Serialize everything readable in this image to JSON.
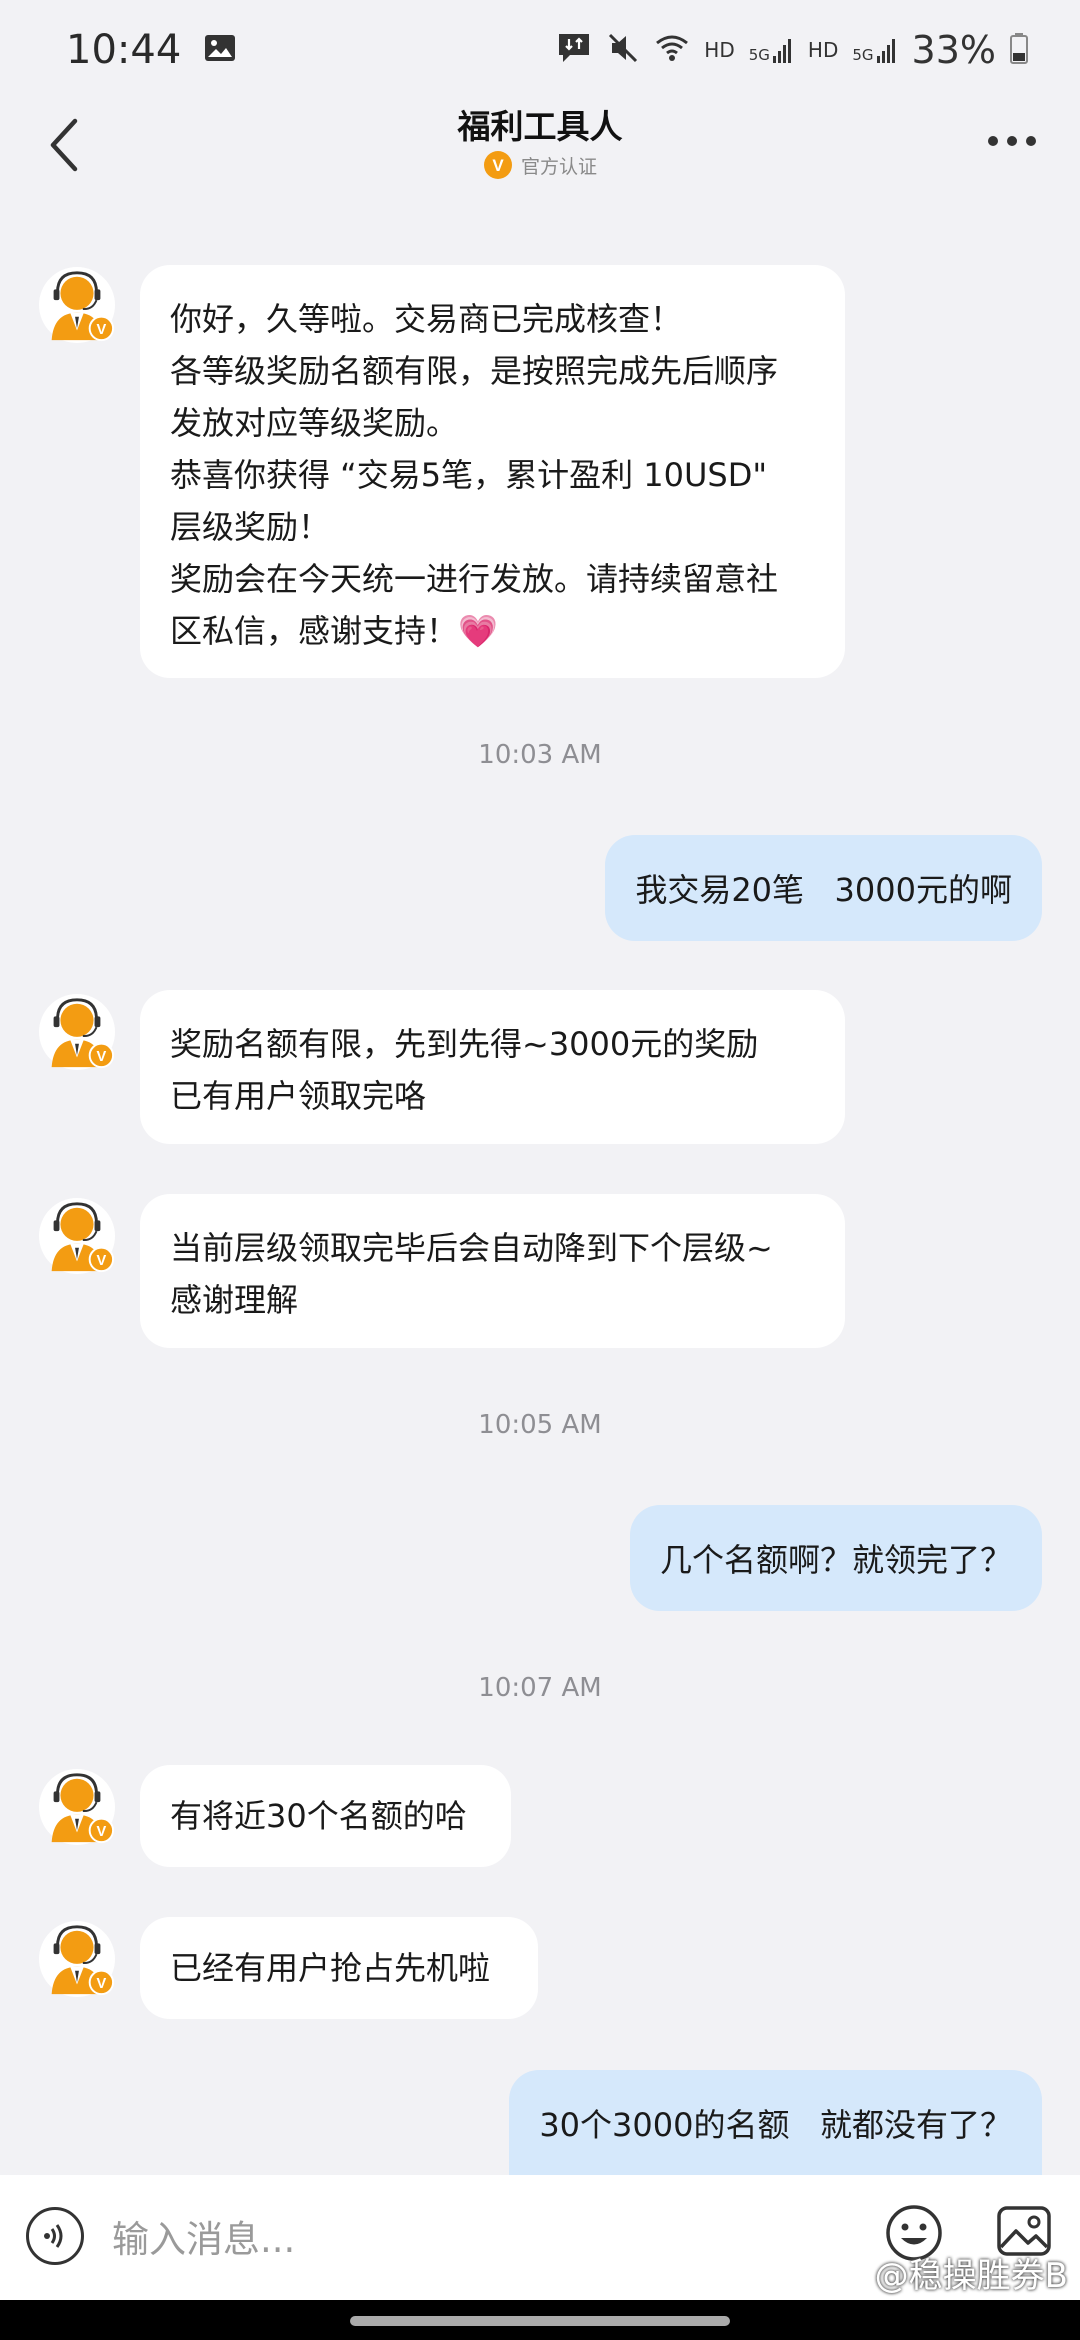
{
  "status": {
    "time": "10:44",
    "hd1": "HD",
    "sig1": "5G",
    "hd2": "HD",
    "sig2": "5G",
    "battery": "33%"
  },
  "header": {
    "title": "福利工具人",
    "badge_letter": "V",
    "verified_label": "官方认证"
  },
  "avatar_badge": "V",
  "messages": [
    {
      "lines": [
        "你好，久等啦。交易商已完成核查！",
        "各等级奖励名额有限，是按照完成先后顺序",
        "发放对应等级奖励。",
        "恭喜你获得 “交易5笔，累计盈利 10USD\"",
        "层级奖励！",
        "奖励会在今天统一进行发放。请持续留意社",
        "区私信，感谢支持！"
      ],
      "emoji": "💗"
    },
    {
      "time": "10:03 AM"
    },
    {
      "text": "我交易20笔   3000元的啊"
    },
    {
      "lines": [
        "奖励名额有限，先到先得~3000元的奖励",
        "已有用户领取完咯"
      ]
    },
    {
      "lines": [
        "当前层级领取完毕后会自动降到下个层级~",
        "感谢理解"
      ]
    },
    {
      "time": "10:05 AM"
    },
    {
      "text": "几个名额啊？就领完了？"
    },
    {
      "time": "10:07 AM"
    },
    {
      "text": "有将近30个名额的哈"
    },
    {
      "text": "已经有用户抢占先机啦"
    },
    {
      "text": "30个3000的名额   就都没有了？"
    }
  ],
  "input": {
    "placeholder": "输入消息..."
  },
  "watermark": "@稳操胜券B",
  "colors": {
    "outgoing_bubble": "#d5e8fb",
    "incoming_bubble": "#ffffff",
    "background": "#f2f2f5",
    "brand_orange": "#f39c12"
  }
}
